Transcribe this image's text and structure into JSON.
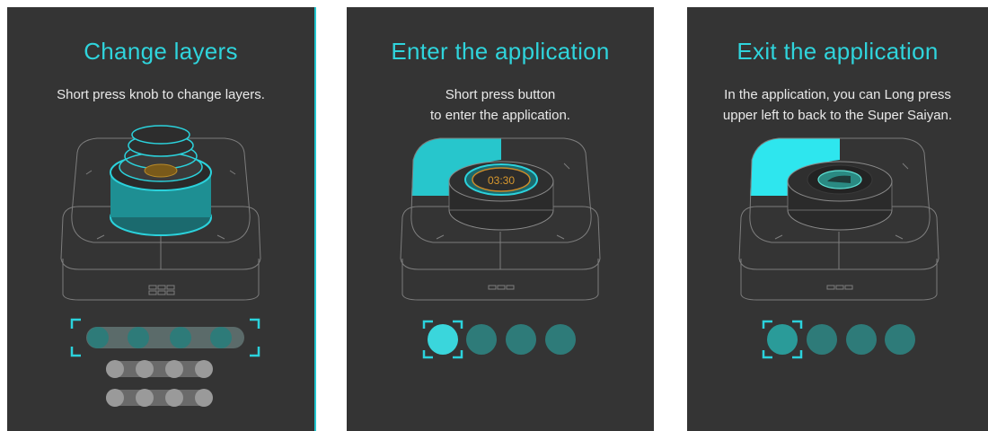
{
  "panels": [
    {
      "title": "Change layers",
      "description": [
        "Short press knob to change layers."
      ],
      "knob_display": ""
    },
    {
      "title": "Enter the application",
      "description": [
        "Short press button",
        "to enter the application."
      ],
      "knob_display": "03:30"
    },
    {
      "title": "Exit the application",
      "description": [
        "In the application, you can Long press",
        "upper left to back to the Super Saiyan."
      ],
      "knob_display": ""
    }
  ],
  "colors": {
    "accent": "#2fd4dc",
    "panel_bg": "#343434",
    "dot_active": "#3ad6dc",
    "dot_teal": "#2e7b79",
    "dot_gray": "#9a9a9a"
  },
  "icons": [
    "knob-device-illustration",
    "selection-bracket-icon",
    "app-icon"
  ]
}
